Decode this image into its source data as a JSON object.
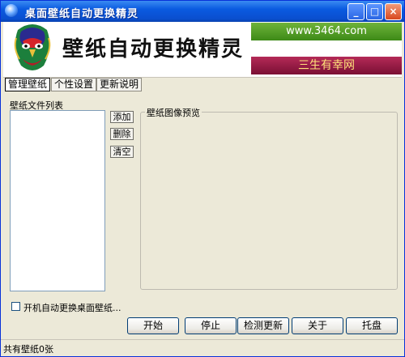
{
  "window": {
    "title": "桌面壁纸自动更换精灵"
  },
  "banner": {
    "title": "壁纸自动更换精灵",
    "ad_top": "www.3464.com",
    "ad_bottom": "三生有幸网"
  },
  "tabs": [
    {
      "label": "管理壁纸",
      "active": true
    },
    {
      "label": "个性设置",
      "active": false
    },
    {
      "label": "更新说明",
      "active": false
    }
  ],
  "list": {
    "label": "壁纸文件列表"
  },
  "side_buttons": {
    "add": "添加",
    "delete": "删除",
    "clear": "清空"
  },
  "preview": {
    "label": "壁纸图像预览"
  },
  "autostart": {
    "label": "开机自动更换桌面壁纸...",
    "checked": false
  },
  "actions": {
    "start": "开始",
    "stop": "停止",
    "check_update": "检测更新",
    "about": "关于",
    "tray": "托盘"
  },
  "status": {
    "text": "共有壁纸0张"
  },
  "icons": [
    "app-icon",
    "minimize-icon",
    "maximize-icon",
    "close-icon",
    "opera-mask-logo"
  ]
}
